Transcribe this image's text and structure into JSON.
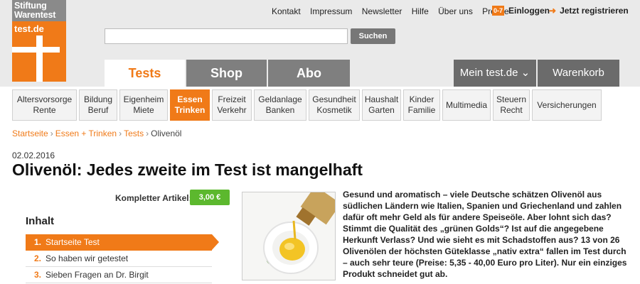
{
  "logo": {
    "line1": "Stiftung",
    "line2": "Warentest",
    "site": "test.de"
  },
  "toplinks": [
    "Kontakt",
    "Impressum",
    "Newsletter",
    "Hilfe",
    "Über uns",
    "Presse"
  ],
  "login": {
    "icon": "0-7",
    "label": "Einloggen"
  },
  "register": {
    "arrow": "➜",
    "label": "Jetzt registrieren"
  },
  "search": {
    "placeholder": "",
    "button": "Suchen"
  },
  "tabs": {
    "tests": "Tests",
    "shop": "Shop",
    "abo": "Abo",
    "mein": "Mein test.de",
    "mein_chevron": "⌄",
    "korb": "Warenkorb"
  },
  "categories": [
    {
      "l1": "Altersvorsorge",
      "l2": "Rente"
    },
    {
      "l1": "Bildung",
      "l2": "Beruf"
    },
    {
      "l1": "Eigenheim",
      "l2": "Miete"
    },
    {
      "l1": "Essen",
      "l2": "Trinken"
    },
    {
      "l1": "Freizeit",
      "l2": "Verkehr"
    },
    {
      "l1": "Geldanlage",
      "l2": "Banken"
    },
    {
      "l1": "Gesundheit",
      "l2": "Kosmetik"
    },
    {
      "l1": "Haushalt",
      "l2": "Garten"
    },
    {
      "l1": "Kinder",
      "l2": "Familie"
    },
    {
      "l1": "Multimedia",
      "l2": ""
    },
    {
      "l1": "Steuern",
      "l2": "Recht"
    },
    {
      "l1": "Versicherungen",
      "l2": ""
    }
  ],
  "breadcrumb": {
    "items": [
      "Startseite",
      "Essen + Trinken",
      "Tests"
    ],
    "current": "Olivenöl",
    "sep": "›"
  },
  "article": {
    "date": "02.02.2016",
    "title_bold": "Olivenöl:",
    "title_rest": " Jedes zweite im Test ist mangelhaft",
    "lead": "Gesund und aromatisch – viele Deutsche schätzen Olivenöl aus südlichen Ländern wie Italien, Spanien und Griechenland und zahlen dafür oft mehr Geld als für andere Speiseöle. Aber lohnt sich das? Stimmt die Qualität des „grünen Golds“? Ist auf die angegebene Herkunft Verlass? Und wie sieht es mit Schadstoffen aus? 13 von 26 Olivenölen der höchsten Güteklasse „nativ extra“ fallen im Test durch – auch sehr teure (Preise: 5,35 - 40,00 Euro pro Liter). Nur ein einziges Produkt schneidet gut ab."
  },
  "buy": {
    "label": "Kompletter Artikel:",
    "price": "3,00 €"
  },
  "toc": {
    "title": "Inhalt",
    "items": [
      {
        "num": "1.",
        "label": "Startseite Test"
      },
      {
        "num": "2.",
        "label": "So haben wir getestet"
      },
      {
        "num": "3.",
        "label": "Sieben Fragen an Dr. Birgit"
      }
    ]
  },
  "colors": {
    "accent": "#f07a18",
    "buy": "#5cb82e",
    "tab_gray": "#7f7f7f"
  }
}
